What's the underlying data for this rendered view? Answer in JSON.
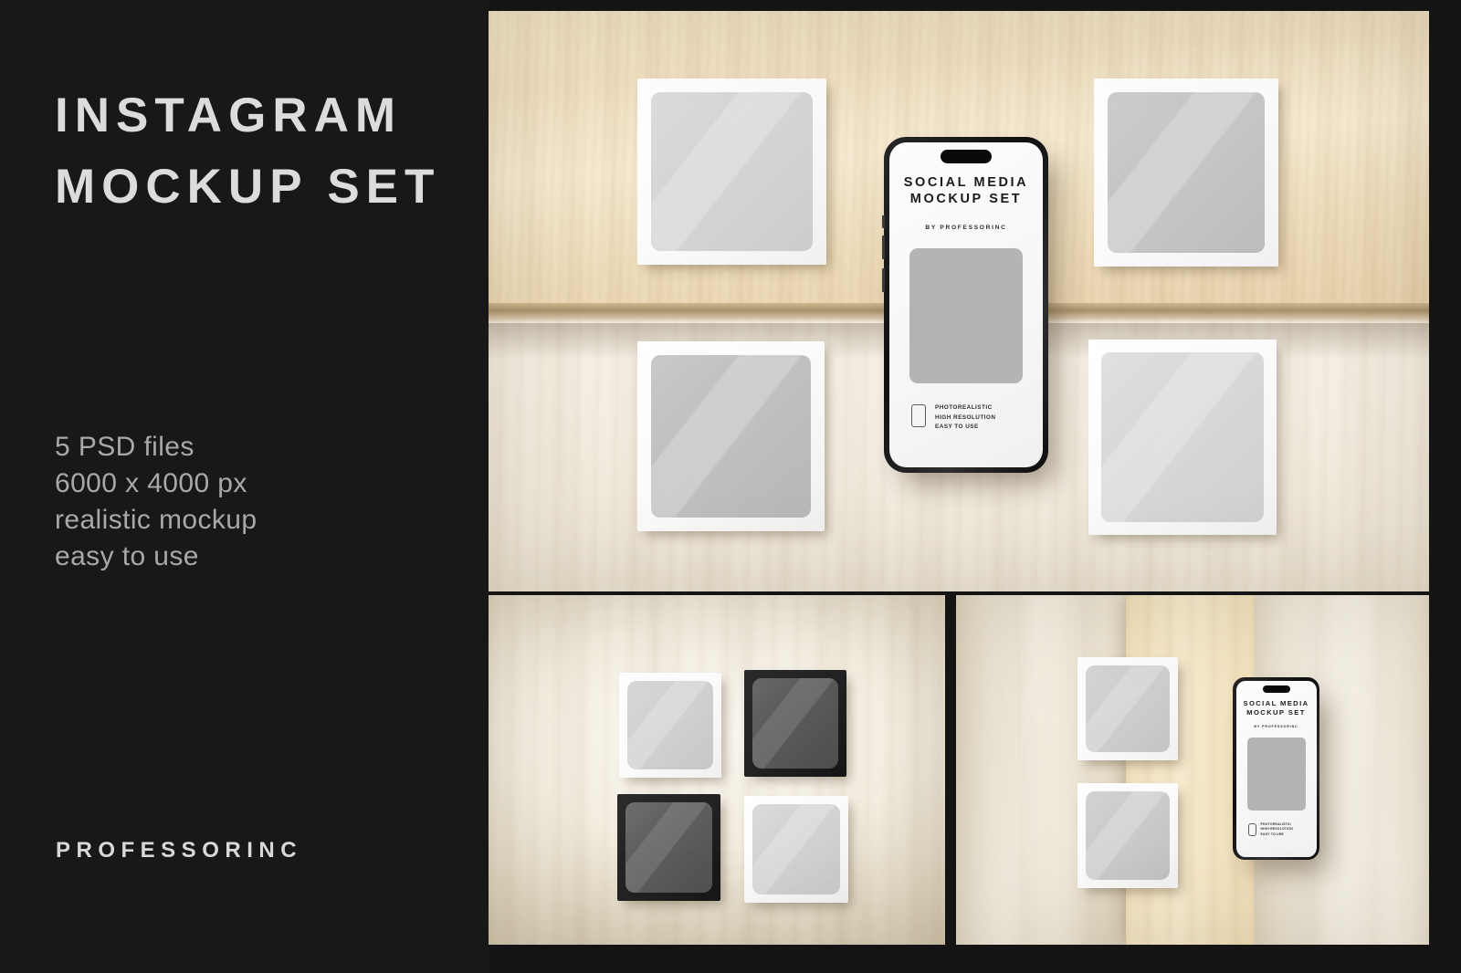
{
  "left_panel": {
    "title_lines": [
      "INSTAGRAM",
      "MOCKUP SET"
    ],
    "specs": [
      "5 PSD files",
      "6000 x 4000 px",
      "realistic mockup",
      "easy to use"
    ],
    "brand": "PROFESSORINC",
    "background_color": "#181818",
    "title_color": "#dcdcdc",
    "spec_color": "#a8a8a8"
  },
  "phone_screen": {
    "title_line1": "SOCIAL MEDIA",
    "title_line2": "MOCKUP SET",
    "byline": "BY PROFESSORINC",
    "features": [
      "PHOTOREALISTIC",
      "HIGH RESOLUTION",
      "EASY TO USE"
    ],
    "placeholder_color": "#b4b4b4",
    "screen_color": "#fafafa"
  },
  "panels": {
    "main": {
      "name": "main-hero-mockup",
      "description": "Four white square frames on light wood with centered phone",
      "frames": [
        {
          "id": "top-left",
          "style": "white",
          "tone": "#d6d6d6"
        },
        {
          "id": "top-right",
          "style": "white",
          "tone": "#c6c6c6"
        },
        {
          "id": "bottom-left",
          "style": "white",
          "tone": "#bfbfbf"
        },
        {
          "id": "bottom-right",
          "style": "white",
          "tone": "#d9d9d9"
        }
      ]
    },
    "bottom_left": {
      "name": "four-frame-grid-mockup",
      "description": "2x2 grid of alternating white and black frames on pale wood",
      "frames": [
        {
          "id": "grid-1",
          "style": "white",
          "tone": "#d2d2d2"
        },
        {
          "id": "grid-2",
          "style": "black",
          "tone": "#5a5a5a"
        },
        {
          "id": "grid-3",
          "style": "black",
          "tone": "#5e5e5e"
        },
        {
          "id": "grid-4",
          "style": "white",
          "tone": "#d4d4d4"
        }
      ]
    },
    "bottom_right": {
      "name": "stacked-frames-phone-mockup",
      "description": "Two stacked white frames beside a phone on multi-tone wood",
      "frames": [
        {
          "id": "stack-top",
          "style": "white",
          "tone": "#cfcfcf"
        },
        {
          "id": "stack-bottom",
          "style": "white",
          "tone": "#cccccc"
        }
      ]
    }
  },
  "colors": {
    "page_background": "#141414",
    "wood_warm": "#f0dfbb",
    "wood_pale": "#f4eee1",
    "frame_white": "#ffffff",
    "frame_black": "#222222"
  }
}
